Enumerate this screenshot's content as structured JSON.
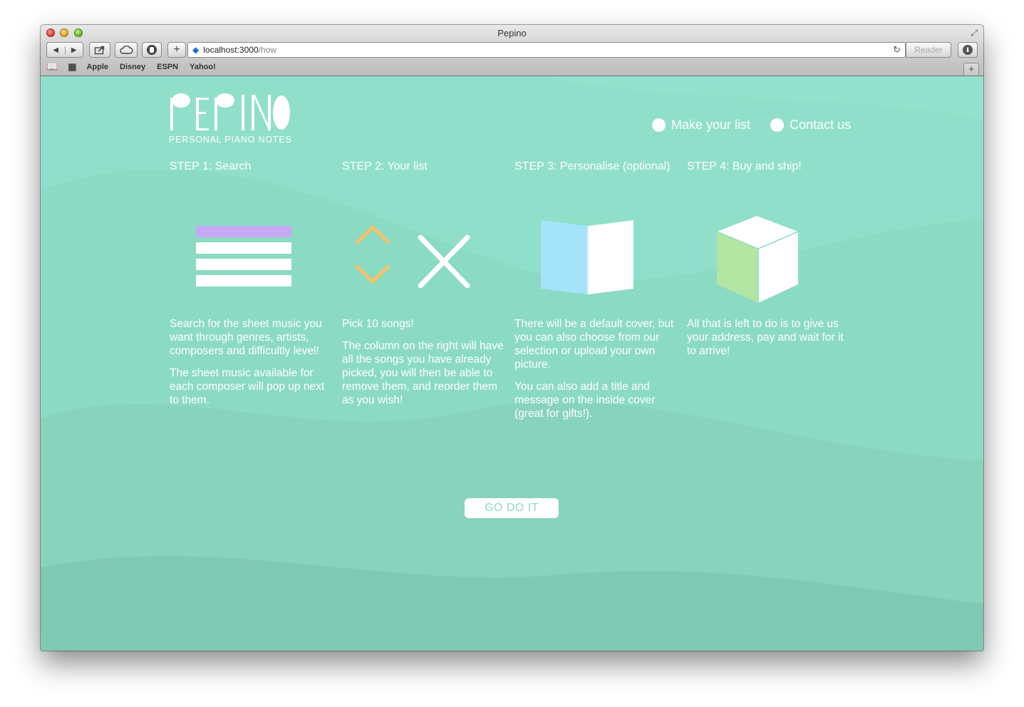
{
  "window": {
    "title": "Pepino"
  },
  "toolbar": {
    "url_host": "localhost:3000",
    "url_path": "/how",
    "reader_label": "Reader"
  },
  "bookmarks": [
    "Apple",
    "Disney",
    "ESPN",
    "Yahoo!"
  ],
  "site": {
    "logo_text": "PEPINO",
    "logo_subtitle": "PERSONAL PIANO NOTES",
    "nav": [
      "Make your list",
      "Contact us"
    ]
  },
  "steps": [
    {
      "title": "STEP 1: Search",
      "icon": "list-icon",
      "paragraphs": [
        "Search for the sheet music you want through genres, artists, composers and difficultly level!",
        "The sheet music available for each composer will pop up next to them."
      ]
    },
    {
      "title": "STEP 2: Your list",
      "icon": "reorder-remove-icon",
      "paragraphs": [
        "Pick 10 songs!",
        "The column on the right will have all the songs you have already picked, you will then be able to remove them, and reorder them as you wish!"
      ]
    },
    {
      "title": "STEP 3: Personalise (optional)",
      "icon": "book-cover-icon",
      "paragraphs": [
        "There will be a default cover, but you can also choose from our selection or upload your own picture.",
        "You can also add a title and message on the inside cover (great for gifts!)."
      ]
    },
    {
      "title": "STEP 4: Buy and ship!",
      "icon": "box-icon",
      "paragraphs": [
        "All that is left to do is to give us your address, pay and wait for it to arrive!"
      ]
    }
  ],
  "cta": {
    "label": "GO DO IT"
  },
  "colors": {
    "background": "#90dfca",
    "wave_dark": "#7fc8b4",
    "list_highlight": "#c6a8f5",
    "arrow_accent": "#f5c26b",
    "cover_blue": "#a5e3fa",
    "box_green": "#b2e6a2",
    "text": "#ffffff"
  }
}
